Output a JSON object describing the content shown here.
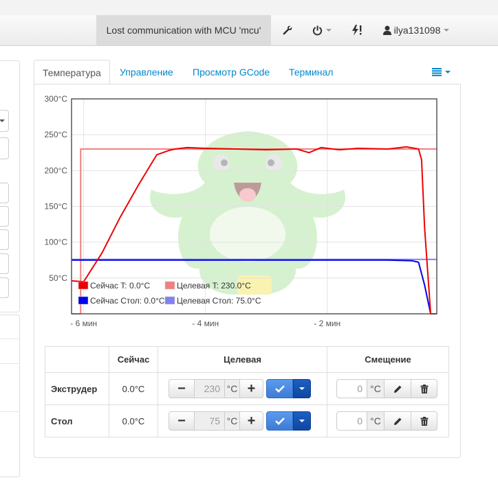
{
  "navbar": {
    "alert": "Lost communication with MCU 'mcu'",
    "username": "ilya131098",
    "icons": [
      "wrench-icon",
      "power-icon",
      "bolt-exclaim-icon",
      "user-icon"
    ]
  },
  "tabs": [
    "Температура",
    "Управление",
    "Просмотр GCode",
    "Терминал"
  ],
  "chart_data": {
    "type": "line",
    "y_ticks": [
      "300°C",
      "250°C",
      "200°C",
      "150°C",
      "100°C",
      "50°C"
    ],
    "x_ticks": [
      "- 6 мин",
      "- 4 мин",
      "- 2 мин"
    ],
    "ylim": [
      0,
      300
    ],
    "xlim": [
      -6.2,
      -0.2
    ],
    "legend": [
      {
        "label": "Сейчас T: 0.0°C",
        "color": "#ee0000"
      },
      {
        "label": "Целевая T: 230.0°C",
        "color": "#f08080"
      },
      {
        "label": "Сейчас Стол: 0.0°C",
        "color": "#0000ee"
      },
      {
        "label": "Целевая Стол: 75.0°C",
        "color": "#8080f0"
      }
    ],
    "series": [
      {
        "name": "Сейчас T",
        "color": "#ee0000",
        "x": [
          -6.2,
          -6.0,
          -5.7,
          -5.4,
          -5.1,
          -4.8,
          -4.6,
          -4.5,
          -4.3,
          -4.0,
          -3.5,
          -3.0,
          -2.5,
          -2.3,
          -2.1,
          -1.8,
          -1.5,
          -1.0,
          -0.7,
          -0.5,
          -0.45,
          -0.4,
          -0.3,
          -0.25,
          -0.2
        ],
        "y": [
          46,
          45,
          85,
          135,
          180,
          222,
          228,
          230,
          232,
          231,
          230,
          229,
          230,
          225,
          232,
          229,
          231,
          230,
          233,
          230,
          215,
          120,
          0,
          0,
          0
        ]
      },
      {
        "name": "Целевая T",
        "color": "#f08080",
        "x": [
          -6.2,
          -6.05,
          -6.05,
          -0.2
        ],
        "y": [
          0,
          0,
          230,
          230
        ]
      },
      {
        "name": "Сейчас Стол",
        "color": "#0000ee",
        "x": [
          -6.2,
          -5.5,
          -4.0,
          -2.0,
          -1.0,
          -0.6,
          -0.5,
          -0.4,
          -0.3,
          -0.2
        ],
        "y": [
          75,
          75,
          75,
          75,
          75,
          74,
          72,
          40,
          0,
          0
        ]
      },
      {
        "name": "Целевая Стол",
        "color": "#8080f0",
        "x": [
          -6.2,
          -0.2
        ],
        "y": [
          76,
          76
        ]
      }
    ]
  },
  "table": {
    "headers": [
      "",
      "Сейчас",
      "Целевая",
      "Смещение"
    ],
    "rows": [
      {
        "name": "Экструдер",
        "current": "0.0°C",
        "target": "230",
        "unit": "°C",
        "offset": "0",
        "offset_unit": "°C"
      },
      {
        "name": "Стол",
        "current": "0.0°C",
        "target": "75",
        "unit": "°C",
        "offset": "0",
        "offset_unit": "°C"
      }
    ],
    "minus": "−",
    "plus": "+"
  }
}
